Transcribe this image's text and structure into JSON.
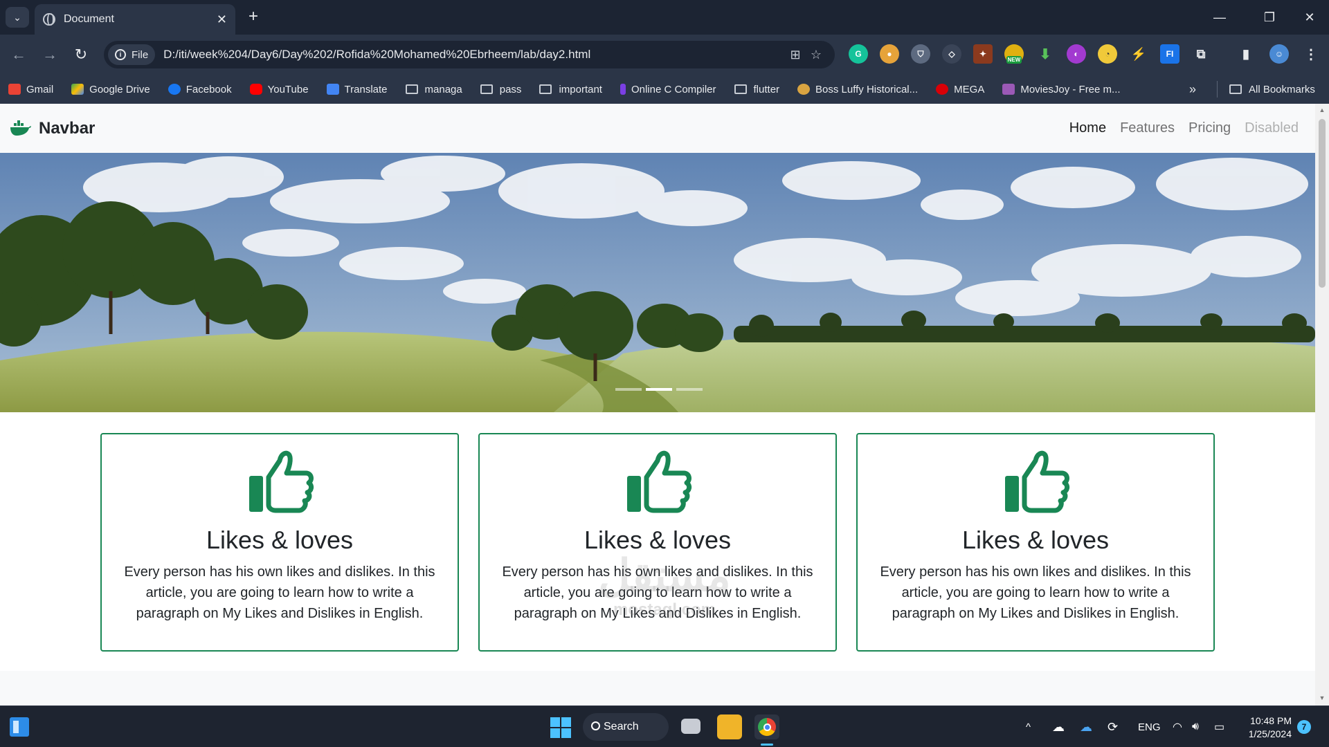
{
  "browser": {
    "tab_title": "Document",
    "url_chip": "File",
    "url": "D:/iti/week%204/Day6/Day%202/Rofida%20Mohamed%20Ebrheem/lab/day2.html",
    "extension_badge": "NEW",
    "bookmarks": [
      "Gmail",
      "Google Drive",
      "Facebook",
      "YouTube",
      "Translate",
      "managa",
      "pass",
      "important",
      "Online C Compiler",
      "flutter",
      "Boss Luffy Historical...",
      "MEGA",
      "MoviesJoy - Free m..."
    ],
    "all_bookmarks": "All Bookmarks"
  },
  "site": {
    "brand": "Navbar",
    "nav": [
      "Home",
      "Features",
      "Pricing",
      "Disabled"
    ],
    "carousel": {
      "slides": 3,
      "active_index": 1
    },
    "cards": [
      {
        "title": "Likes & loves",
        "text": "Every person has his own likes and dislikes. In this article, you are going to learn how to write a paragraph on My Likes and Dislikes in English."
      },
      {
        "title": "Likes & loves",
        "text": "Every person has his own likes and dislikes. In this article, you are going to learn how to write a paragraph on My Likes and Dislikes in English."
      },
      {
        "title": "Likes & loves",
        "text": "Every person has his own likes and dislikes. In this article, you are going to learn how to write a paragraph on My Likes and Dislikes in English."
      }
    ],
    "accent_color": "#198754"
  },
  "watermark": {
    "arabic": "مستقل",
    "latin": "mostaql.com"
  },
  "taskbar": {
    "search_label": "Search",
    "language": "ENG",
    "time": "10:48 PM",
    "date": "1/25/2024",
    "notification_count": "7"
  }
}
